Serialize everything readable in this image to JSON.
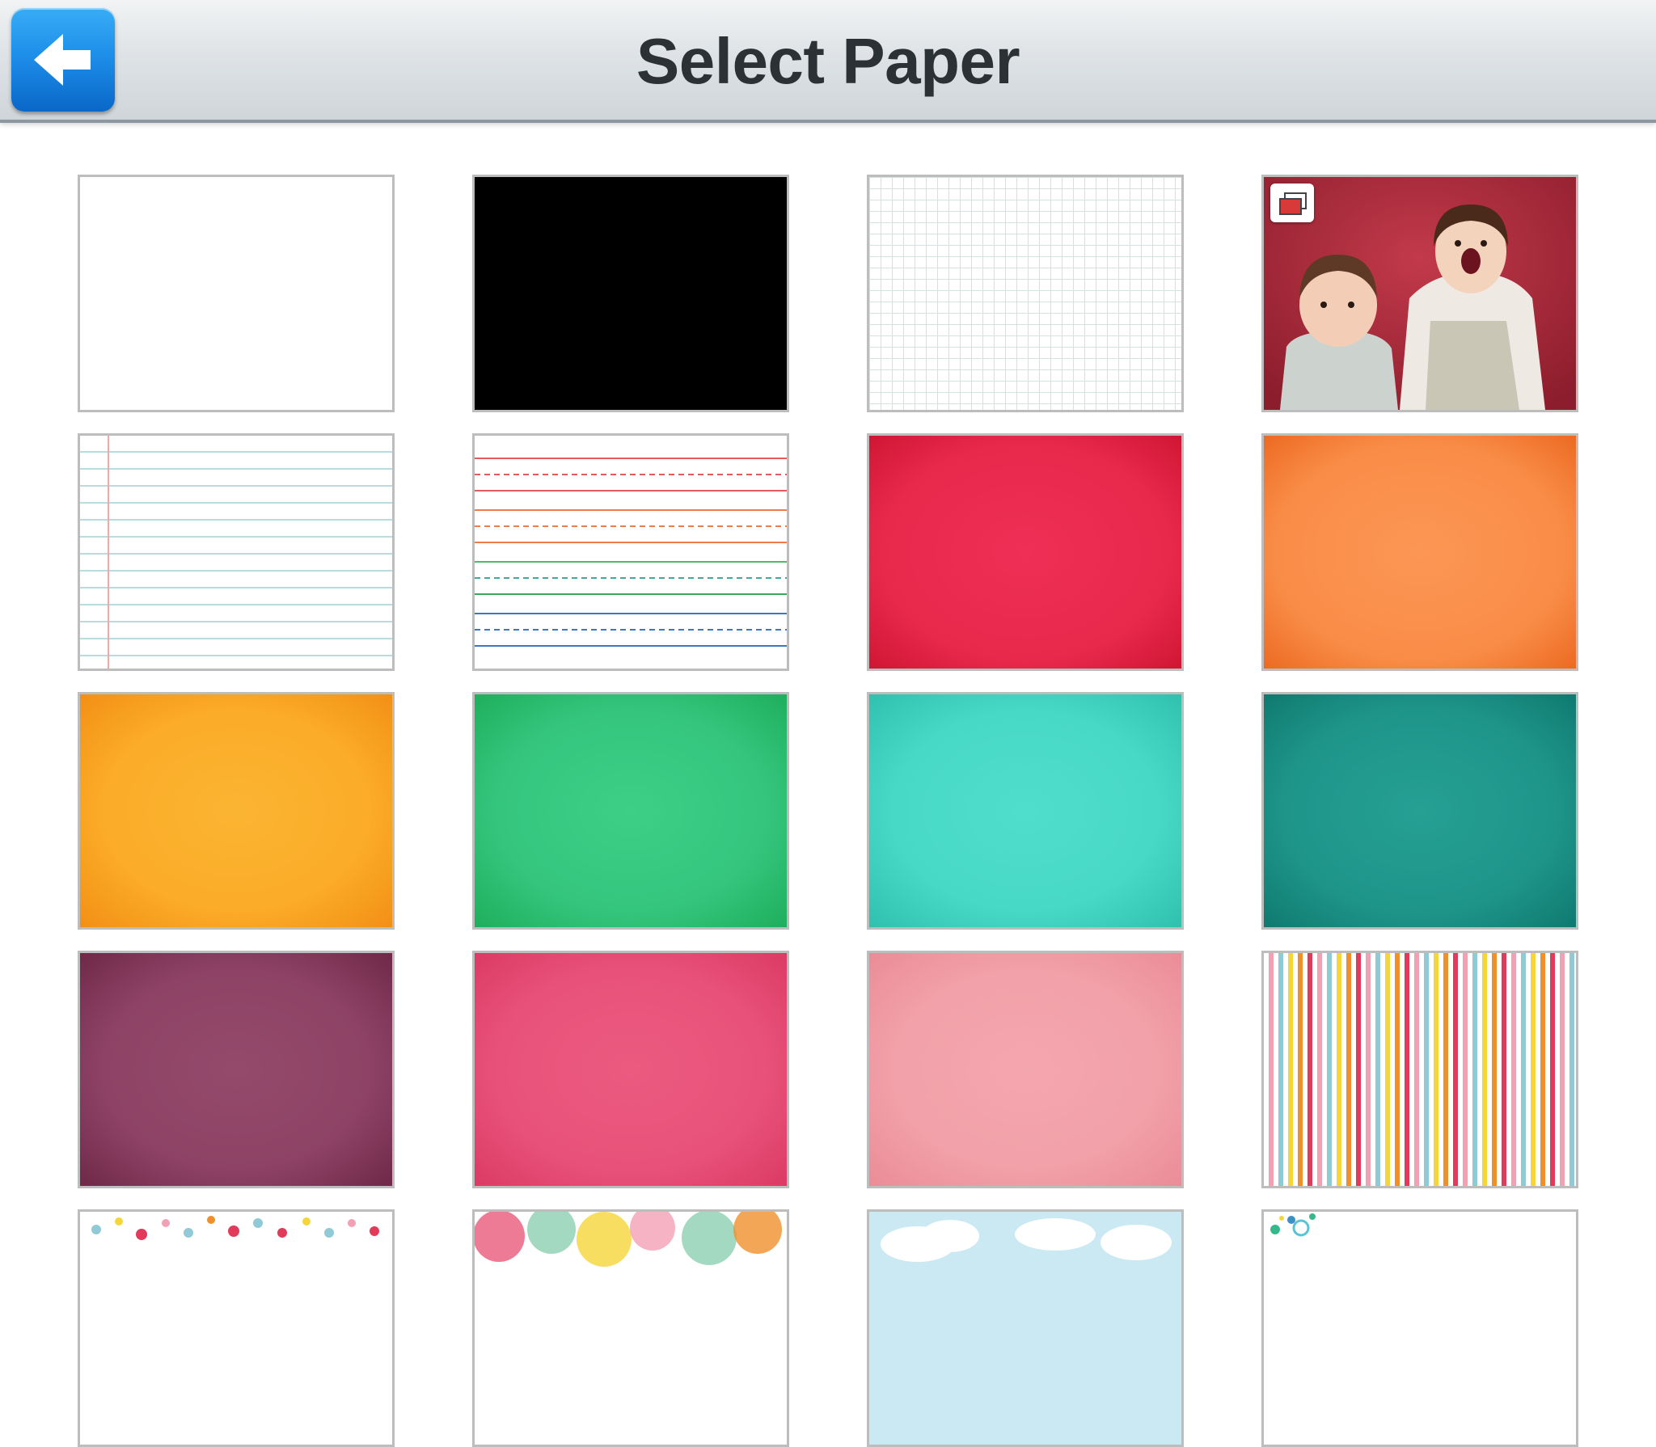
{
  "header": {
    "title": "Select Paper",
    "back_icon": "left-arrow-icon"
  },
  "papers": [
    {
      "name": "white",
      "color": "#ffffff"
    },
    {
      "name": "black",
      "color": "#000000"
    },
    {
      "name": "graph",
      "color": "#ffffff"
    },
    {
      "name": "photo",
      "icon": "photo-gallery-icon"
    },
    {
      "name": "notebook-lined",
      "color": "#ffffff"
    },
    {
      "name": "handwriting-lined",
      "color": "#ffffff"
    },
    {
      "name": "red",
      "color": "#e8294c"
    },
    {
      "name": "orange",
      "color": "#f98d47"
    },
    {
      "name": "yellow-orange",
      "color": "#fbb12a"
    },
    {
      "name": "green",
      "color": "#35c67e"
    },
    {
      "name": "turquoise",
      "color": "#48d8c6"
    },
    {
      "name": "teal",
      "color": "#1f958a"
    },
    {
      "name": "plum",
      "color": "#8e4366"
    },
    {
      "name": "pink",
      "color": "#e8527a"
    },
    {
      "name": "light-pink",
      "color": "#f2a0a9"
    },
    {
      "name": "stripes"
    },
    {
      "name": "confetti-dots"
    },
    {
      "name": "bubbles"
    },
    {
      "name": "clouds"
    },
    {
      "name": "dots-corner"
    }
  ]
}
